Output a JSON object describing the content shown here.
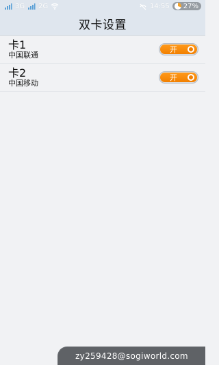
{
  "status_bar": {
    "sim1_signal_label": "3G",
    "sim2_signal_label": "2G",
    "time": "14:55",
    "battery": "27%",
    "icons": {
      "sim1": "signal-icon",
      "sim2": "signal-icon",
      "wifi": "wifi-icon",
      "mute": "mute-icon",
      "battery": "battery-icon"
    }
  },
  "header": {
    "title": "双卡设置"
  },
  "sim_cards": [
    {
      "name": "卡1",
      "carrier": "中国联通",
      "toggle_label": "开",
      "toggle_on": true
    },
    {
      "name": "卡2",
      "carrier": "中国移动",
      "toggle_label": "开",
      "toggle_on": true
    }
  ],
  "watermark": {
    "text": "zy259428@sogiworld.com"
  },
  "colors": {
    "accent": "#f27f00",
    "background": "#f1f2f4",
    "header_bg": "#dfe6ee",
    "watermark_bg": "#5f6266"
  }
}
